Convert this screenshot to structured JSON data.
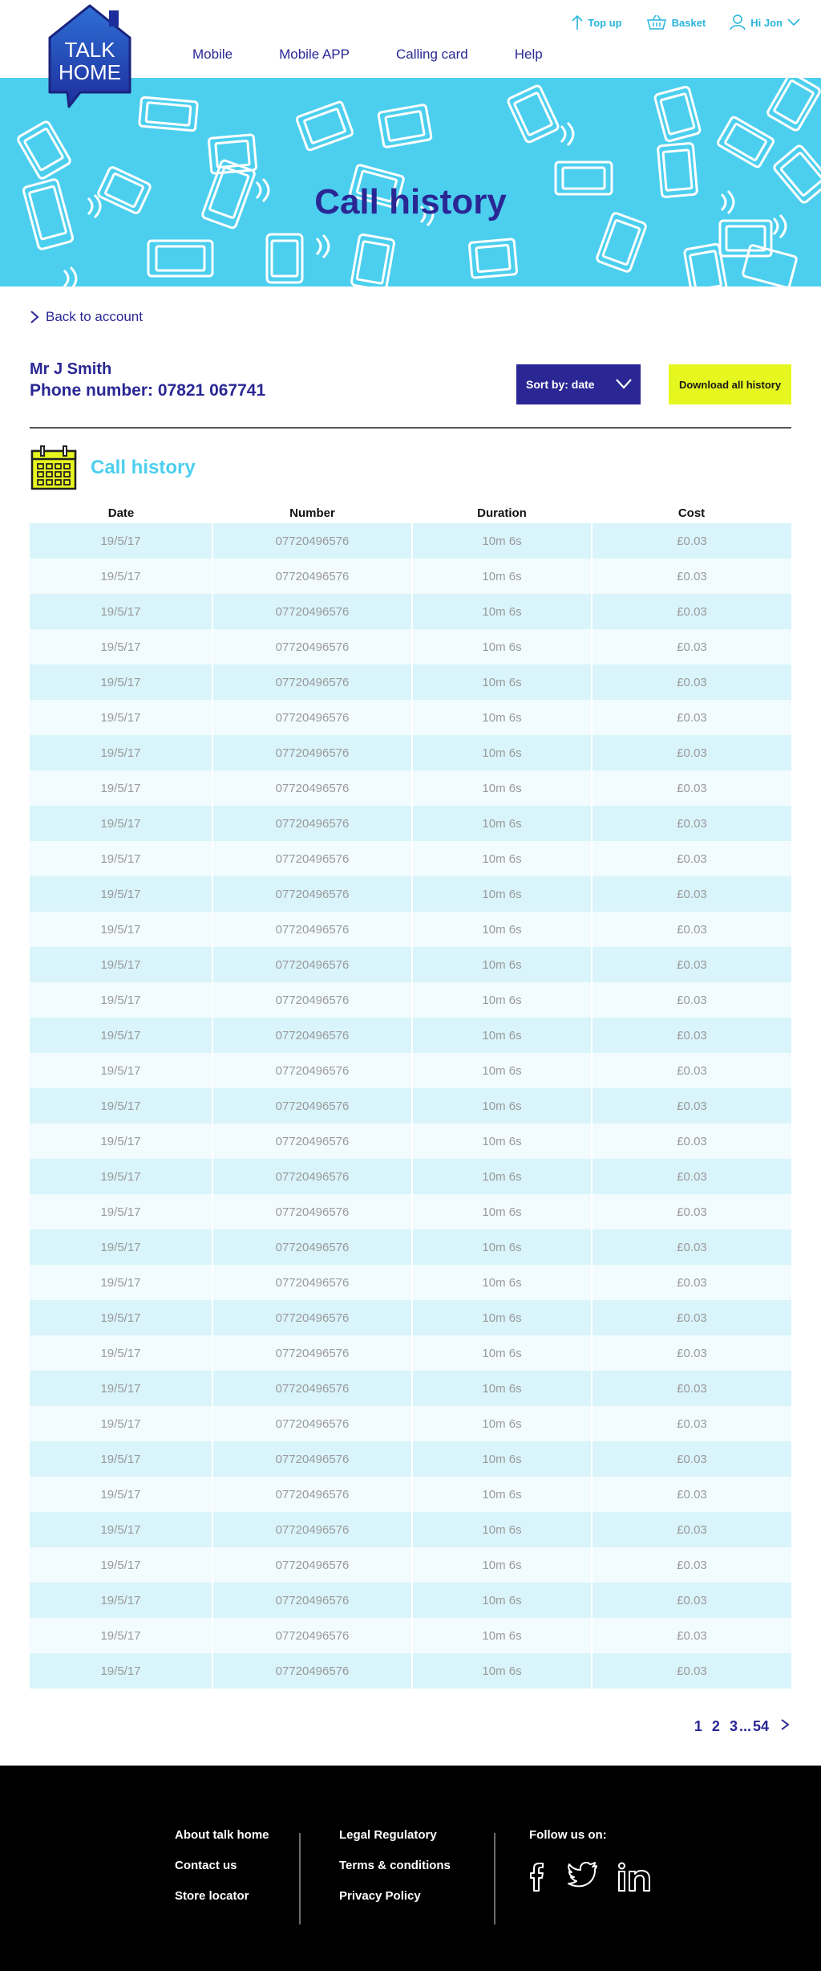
{
  "header": {
    "logo_text": [
      "TALK",
      "HOME"
    ],
    "nav": [
      "Mobile",
      "Mobile APP",
      "Calling card",
      "Help"
    ],
    "top_up": "Top up",
    "basket": "Basket",
    "user": "Hi Jon"
  },
  "hero": {
    "title": "Call history"
  },
  "back_link": "Back to account",
  "account": {
    "name": "Mr J Smith",
    "phone": "Phone number: 07821 067741",
    "sort_label": "Sort by: date",
    "download_label": "Download all history"
  },
  "section_title": "Call history",
  "table": {
    "headers": [
      "Date",
      "Number",
      "Duration",
      "Cost"
    ],
    "rows": [
      [
        "19/5/17",
        "07720496576",
        "10m 6s",
        "£0.03"
      ],
      [
        "19/5/17",
        "07720496576",
        "10m 6s",
        "£0.03"
      ],
      [
        "19/5/17",
        "07720496576",
        "10m 6s",
        "£0.03"
      ],
      [
        "19/5/17",
        "07720496576",
        "10m 6s",
        "£0.03"
      ],
      [
        "19/5/17",
        "07720496576",
        "10m 6s",
        "£0.03"
      ],
      [
        "19/5/17",
        "07720496576",
        "10m 6s",
        "£0.03"
      ],
      [
        "19/5/17",
        "07720496576",
        "10m 6s",
        "£0.03"
      ],
      [
        "19/5/17",
        "07720496576",
        "10m 6s",
        "£0.03"
      ],
      [
        "19/5/17",
        "07720496576",
        "10m 6s",
        "£0.03"
      ],
      [
        "19/5/17",
        "07720496576",
        "10m 6s",
        "£0.03"
      ],
      [
        "19/5/17",
        "07720496576",
        "10m 6s",
        "£0.03"
      ],
      [
        "19/5/17",
        "07720496576",
        "10m 6s",
        "£0.03"
      ],
      [
        "19/5/17",
        "07720496576",
        "10m 6s",
        "£0.03"
      ],
      [
        "19/5/17",
        "07720496576",
        "10m 6s",
        "£0.03"
      ],
      [
        "19/5/17",
        "07720496576",
        "10m 6s",
        "£0.03"
      ],
      [
        "19/5/17",
        "07720496576",
        "10m 6s",
        "£0.03"
      ],
      [
        "19/5/17",
        "07720496576",
        "10m 6s",
        "£0.03"
      ],
      [
        "19/5/17",
        "07720496576",
        "10m 6s",
        "£0.03"
      ],
      [
        "19/5/17",
        "07720496576",
        "10m 6s",
        "£0.03"
      ],
      [
        "19/5/17",
        "07720496576",
        "10m 6s",
        "£0.03"
      ],
      [
        "19/5/17",
        "07720496576",
        "10m 6s",
        "£0.03"
      ],
      [
        "19/5/17",
        "07720496576",
        "10m 6s",
        "£0.03"
      ],
      [
        "19/5/17",
        "07720496576",
        "10m 6s",
        "£0.03"
      ],
      [
        "19/5/17",
        "07720496576",
        "10m 6s",
        "£0.03"
      ],
      [
        "19/5/17",
        "07720496576",
        "10m 6s",
        "£0.03"
      ],
      [
        "19/5/17",
        "07720496576",
        "10m 6s",
        "£0.03"
      ],
      [
        "19/5/17",
        "07720496576",
        "10m 6s",
        "£0.03"
      ],
      [
        "19/5/17",
        "07720496576",
        "10m 6s",
        "£0.03"
      ],
      [
        "19/5/17",
        "07720496576",
        "10m 6s",
        "£0.03"
      ],
      [
        "19/5/17",
        "07720496576",
        "10m 6s",
        "£0.03"
      ],
      [
        "19/5/17",
        "07720496576",
        "10m 6s",
        "£0.03"
      ],
      [
        "19/5/17",
        "07720496576",
        "10m 6s",
        "£0.03"
      ],
      [
        "19/5/17",
        "07720496576",
        "10m 6s",
        "£0.03"
      ]
    ]
  },
  "pagination": [
    "1",
    "2",
    "3",
    "...",
    "54"
  ],
  "footer": {
    "col1": [
      "About talk home",
      "Contact us",
      "Store locator"
    ],
    "col2": [
      "Legal Regulatory",
      "Terms & conditions",
      "Privacy Policy"
    ],
    "follow": "Follow us on:",
    "social": [
      "facebook-icon",
      "twitter-icon",
      "linkedin-icon"
    ]
  },
  "colors": {
    "navy": "#2a2795",
    "cyan": "#4ccfee",
    "accent_yellow": "#e6f71f",
    "row_dark": "#d9f4fb",
    "row_light": "#f2fbfe"
  }
}
